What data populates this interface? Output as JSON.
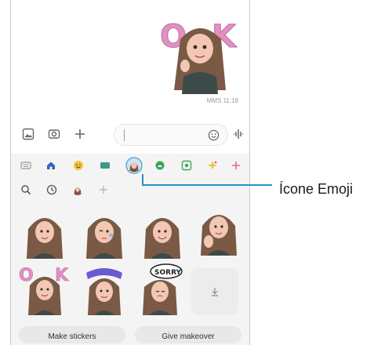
{
  "chat": {
    "timestamp": "MMS 11:18"
  },
  "input_bar": {
    "icons": [
      "gallery-icon",
      "camera-icon",
      "add-icon",
      "emoji-face-icon",
      "voice-icon"
    ],
    "message_value": ""
  },
  "sticker_tabs": {
    "items": [
      "keyboard-icon",
      "home-icon",
      "emoji-icon",
      "gif-icon",
      "emoji-avatar-icon",
      "sticker-icon",
      "sparkle-icon",
      "add-icon"
    ],
    "selected": "emoji-avatar-icon"
  },
  "sub_tabs": {
    "items": [
      "search-icon",
      "recent-icon",
      "avatar-icon",
      "add-icon"
    ]
  },
  "buttons": {
    "make_stickers": "Make stickers",
    "give_makeover": "Give makeover"
  },
  "callout": {
    "label": "Ícone Emoji"
  },
  "colors": {
    "accent": "#2a90c8",
    "avatar_hair": "#7a5a44",
    "avatar_skin": "#f2c7b3"
  }
}
